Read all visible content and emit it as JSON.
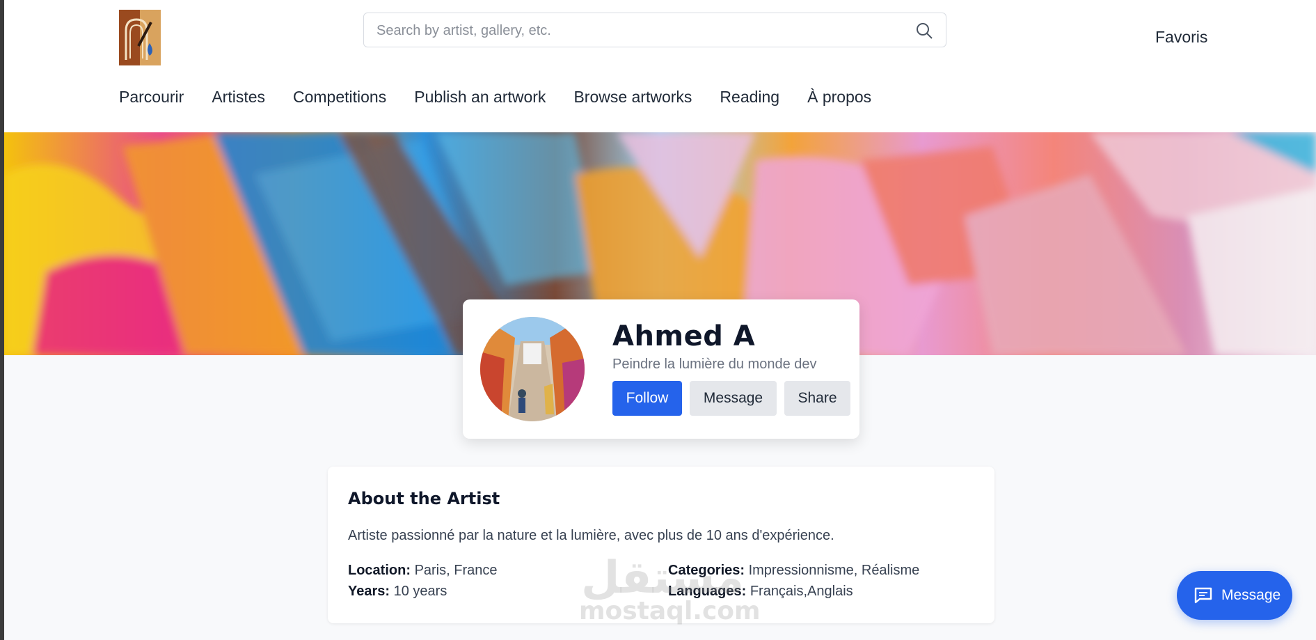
{
  "header": {
    "search_placeholder": "Search by artist, gallery, etc.",
    "favorites_label": "Favoris",
    "logo_icon": "paintbrush-logo-icon"
  },
  "nav": {
    "items": [
      {
        "label": "Parcourir"
      },
      {
        "label": "Artistes"
      },
      {
        "label": "Competitions"
      },
      {
        "label": "Publish an artwork"
      },
      {
        "label": "Browse artworks"
      },
      {
        "label": "Reading"
      },
      {
        "label": "À propos"
      }
    ]
  },
  "profile": {
    "name": "Ahmed A",
    "tagline": "Peindre la lumière du monde dev",
    "follow_label": "Follow",
    "message_label": "Message",
    "share_label": "Share"
  },
  "about": {
    "title": "About the Artist",
    "bio": "Artiste passionné par la nature et la lumière, avec plus de 10 ans d'expérience.",
    "location_label": "Location:",
    "location_value": "Paris, France",
    "years_label": "Years:",
    "years_value": "10 years",
    "categories_label": "Categories:",
    "categories_value": "Impressionnisme, Réalisme",
    "languages_label": "Languages:",
    "languages_value": "Français,Anglais"
  },
  "watermark": {
    "arabic": "مستقل",
    "latin": "mostaql.com"
  },
  "floating": {
    "message_label": "Message"
  },
  "colors": {
    "accent": "#2563eb",
    "secondary_button": "#e5e7eb",
    "page_background": "#f8f9fb"
  }
}
